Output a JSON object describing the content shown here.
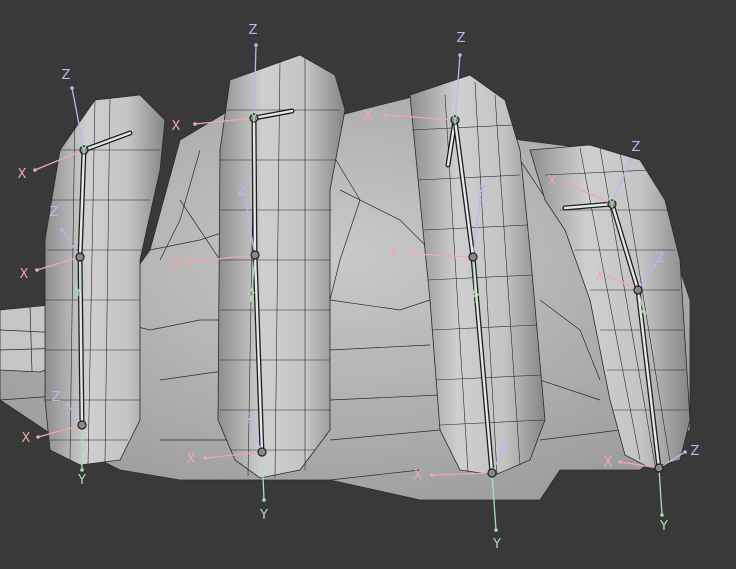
{
  "colors": {
    "background": "#393939",
    "mesh_fill": "#c8c8c8",
    "mesh_shade": "#9c9c9c",
    "wire": "#2a2a2a",
    "bone": "#e6e6e6",
    "axis_x": "#f2a8a8",
    "axis_y": "#a8e0b0",
    "axis_z": "#b8b8f0"
  },
  "axis_labels": {
    "x": "X",
    "y": "Y",
    "z": "Z"
  },
  "fingers": [
    {
      "name": "index",
      "joints": 3
    },
    {
      "name": "middle",
      "joints": 3
    },
    {
      "name": "ring",
      "joints": 3
    },
    {
      "name": "pinky",
      "joints": 3
    }
  ]
}
